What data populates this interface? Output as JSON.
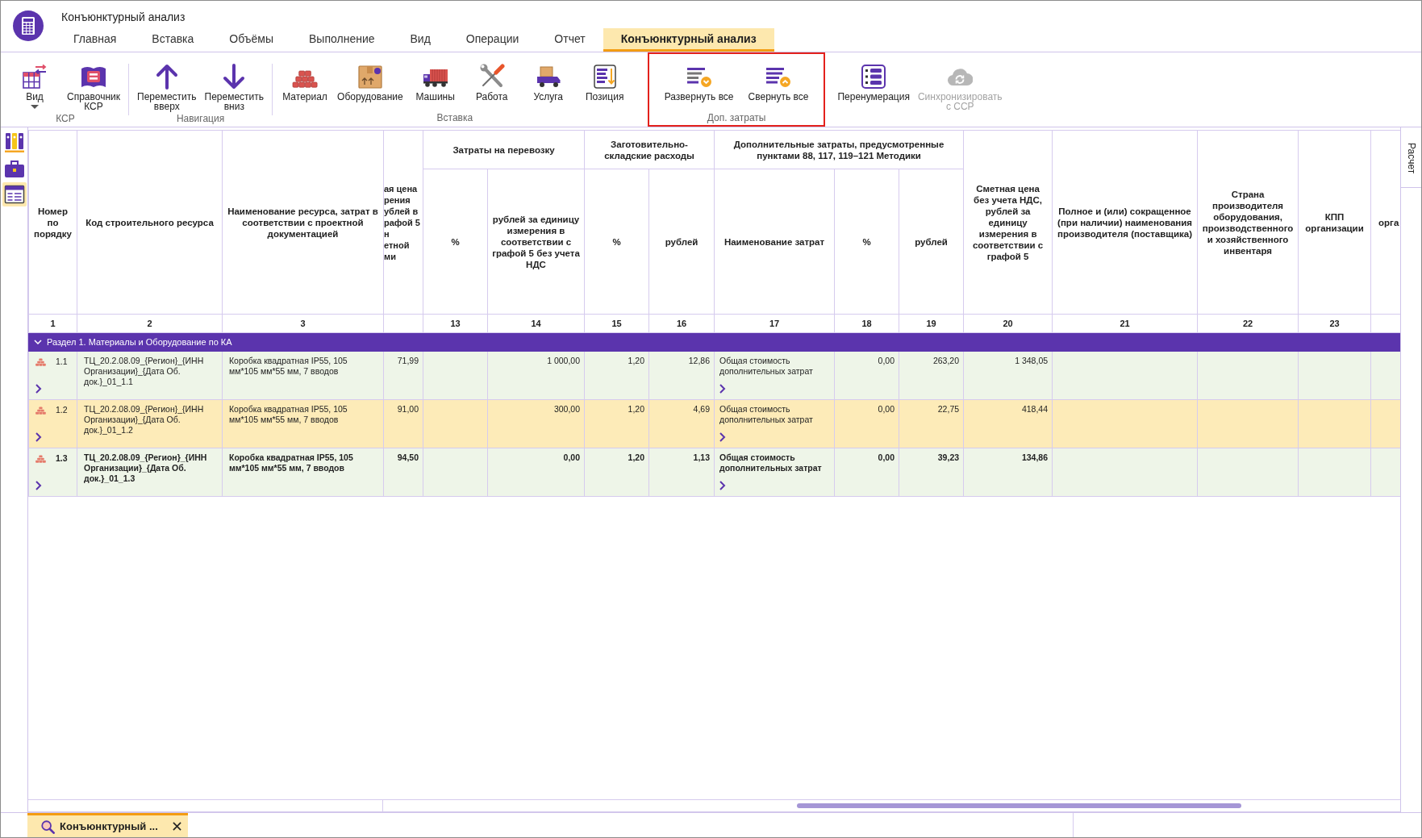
{
  "window": {
    "title": "Конъюнктурный анализ"
  },
  "ribbon_tabs": [
    {
      "label": "Главная",
      "selected": false
    },
    {
      "label": "Вставка",
      "selected": false
    },
    {
      "label": "Объёмы",
      "selected": false
    },
    {
      "label": "Выполнение",
      "selected": false
    },
    {
      "label": "Вид",
      "selected": false
    },
    {
      "label": "Операции",
      "selected": false
    },
    {
      "label": "Отчет",
      "selected": false
    },
    {
      "label": "Конъюнктурный анализ",
      "selected": true
    }
  ],
  "ribbon_groups": [
    {
      "label": "КСР",
      "highlighted": false,
      "buttons": [
        {
          "label": "Вид",
          "dropdown": true,
          "disabled": false
        },
        {
          "label": "Справочник\nКСР",
          "dropdown": false,
          "disabled": false
        }
      ]
    },
    {
      "label": "Навигация",
      "highlighted": false,
      "buttons": [
        {
          "label": "Переместить\nвверх",
          "dropdown": false,
          "disabled": false
        },
        {
          "label": "Переместить\nвниз",
          "dropdown": false,
          "disabled": false
        }
      ]
    },
    {
      "label": "Вставка",
      "highlighted": false,
      "buttons": [
        {
          "label": "Материал",
          "dropdown": false,
          "disabled": false
        },
        {
          "label": "Оборудование",
          "dropdown": false,
          "disabled": false
        },
        {
          "label": "Машины",
          "dropdown": false,
          "disabled": false
        },
        {
          "label": "Работа",
          "dropdown": false,
          "disabled": false
        },
        {
          "label": "Услуга",
          "dropdown": false,
          "disabled": false
        },
        {
          "label": "Позиция",
          "dropdown": false,
          "disabled": false
        }
      ]
    },
    {
      "label": "Доп. затраты",
      "highlighted": true,
      "buttons": [
        {
          "label": "Развернуть все",
          "dropdown": false,
          "disabled": false
        },
        {
          "label": "Свернуть все",
          "dropdown": false,
          "disabled": false
        }
      ]
    },
    {
      "highlighted": false,
      "buttons": [
        {
          "label": "Перенумерация",
          "dropdown": false,
          "disabled": false
        },
        {
          "label": "Синхронизировать\nс ССР",
          "dropdown": false,
          "disabled": true
        }
      ]
    }
  ],
  "side_toolbar": [
    {
      "selected": false
    },
    {
      "selected": false
    },
    {
      "selected": true
    }
  ],
  "table": {
    "columns": [
      {
        "header": "Номер по порядку",
        "number": "1",
        "kind": "full"
      },
      {
        "header": "Код строительного ресурса",
        "number": "2",
        "kind": "full"
      },
      {
        "header": "Наименование ресурса, затрат в соответствии с проектной документацией",
        "number": "3",
        "kind": "full"
      },
      {
        "header": "ая цена\nрения\nублей в\nрафой 5\nн\nетной\nми",
        "kind": "cut_left"
      },
      {
        "group": "Затраты на перевозку",
        "columns": [
          {
            "header": "%",
            "number": "13",
            "kind": "full"
          },
          {
            "header": "рублей за единицу измерения в соответствии с графой 5 без учета НДС",
            "number": "14",
            "kind": "full"
          }
        ]
      },
      {
        "group": "Заготовительно-складские расходы",
        "columns": [
          {
            "header": "%",
            "number": "15",
            "kind": "full"
          },
          {
            "header": "рублей",
            "number": "16",
            "kind": "full"
          }
        ]
      },
      {
        "group": "Дополнительные затраты, предусмотренные пунктами 88, 117, 119–121 Методики",
        "columns": [
          {
            "header": "Наименование затрат",
            "number": "17",
            "kind": "full"
          },
          {
            "header": "%",
            "number": "18",
            "kind": "full"
          },
          {
            "header": "рублей",
            "number": "19",
            "kind": "full"
          }
        ]
      },
      {
        "header": "Сметная цена без учета НДС, рублей за единицу измерения в соответствии с графой 5",
        "number": "20",
        "kind": "full"
      },
      {
        "header": "Полное и (или) сокращенное (при наличии) наименования производителя (поставщика)",
        "number": "21",
        "kind": "full"
      },
      {
        "header": "Страна производителя оборудования, производственного и хозяйственного инвентаря",
        "number": "22",
        "kind": "full"
      },
      {
        "header": "КПП организации",
        "number": "23",
        "kind": "full"
      },
      {
        "header": "орга",
        "kind": "cut_right"
      }
    ],
    "section": {
      "title": "Раздел 1. Материалы и Оборудование по КА",
      "expanded": true
    },
    "rows": [
      {
        "number": "1.1",
        "code": "ТЦ_20.2.08.09_{Регион}_{ИНН Организации}_{Дата Об. док.}_01_1.1",
        "name": "Коробка квадратная IP55, 105 мм*105 мм*55 мм, 7 вводов",
        "column_4": "71,99",
        "transport_rub": "1 000,00",
        "storage_percent": "1,20",
        "storage_rub": "12,86",
        "extra_cost_name": "Общая стоимость дополнительных затрат",
        "extra_percent": "0,00",
        "extra_rub": "263,20",
        "estimated_price": "1 348,05",
        "selected": false,
        "bold": false,
        "expanded": false,
        "costs_expanded": false
      },
      {
        "number": "1.2",
        "code": "ТЦ_20.2.08.09_{Регион}_{ИНН Организации}_{Дата Об. док.}_01_1.2",
        "name": "Коробка квадратная IP55, 105 мм*105 мм*55 мм, 7 вводов",
        "column_4": "91,00",
        "transport_rub": "300,00",
        "storage_percent": "1,20",
        "storage_rub": "4,69",
        "extra_cost_name": "Общая стоимость дополнительных затрат",
        "extra_percent": "0,00",
        "extra_rub": "22,75",
        "estimated_price": "418,44",
        "selected": true,
        "bold": false,
        "expanded": false,
        "costs_expanded": false
      },
      {
        "number": "1.3",
        "code": "ТЦ_20.2.08.09_{Регион}_{ИНН Организации}_{Дата Об. док.}_01_1.3",
        "name": "Коробка квадратная IP55, 105 мм*105 мм*55 мм, 7 вводов",
        "column_4": "94,50",
        "transport_rub": "0,00",
        "storage_percent": "1,20",
        "storage_rub": "1,13",
        "extra_cost_name": "Общая стоимость дополнительных затрат",
        "extra_percent": "0,00",
        "extra_rub": "39,23",
        "estimated_price": "134,86",
        "selected": false,
        "bold": true,
        "expanded": false,
        "costs_expanded": false
      }
    ]
  },
  "right_panel": {
    "tabs": [
      {
        "label": "Расчет",
        "selected": false
      }
    ]
  },
  "document_tabs": [
    {
      "label": "Конъюнктурный ...",
      "selected": true
    }
  ]
}
